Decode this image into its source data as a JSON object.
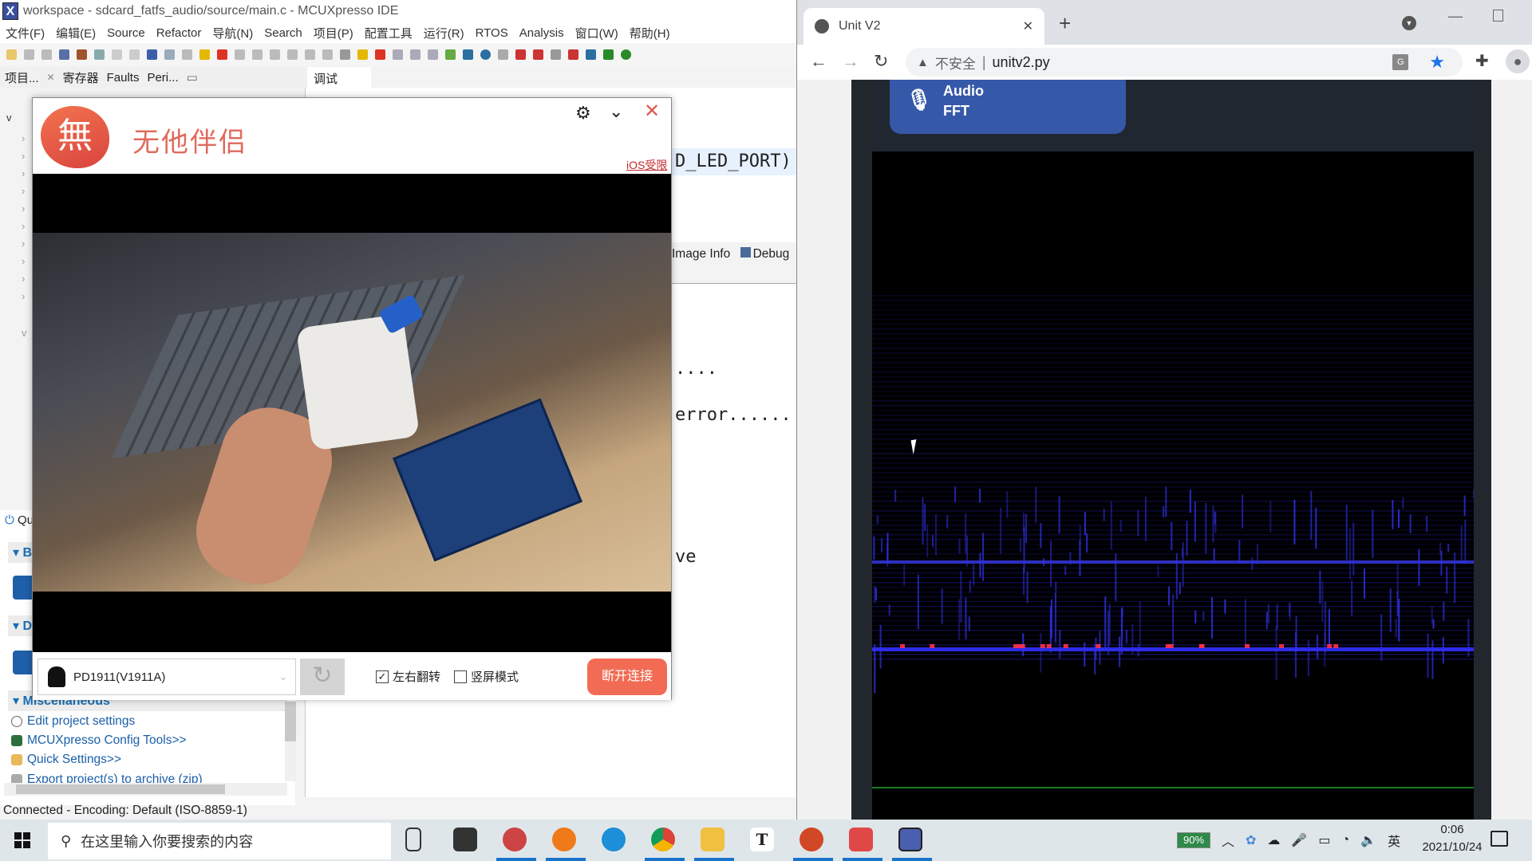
{
  "ide": {
    "title": "workspace - sdcard_fatfs_audio/source/main.c - MCUXpresso IDE",
    "logo": "X",
    "menu": [
      "文件(F)",
      "编辑(E)",
      "Source",
      "Refactor",
      "导航(N)",
      "Search",
      "项目(P)",
      "配置工具",
      "运行(R)",
      "RTOS",
      "Analysis",
      "窗口(W)",
      "帮助(H)"
    ],
    "view_tabs": [
      "项目...",
      "寄存器",
      "Faults",
      "Peri..."
    ],
    "debug_tab": "调试",
    "quickstart": {
      "header": "Qu",
      "sections": [
        "Bu",
        "D",
        "Miscellaneous"
      ],
      "links": [
        "Edit project settings",
        "MCUXpresso Config Tools>>",
        "Quick Settings>>",
        "Export project(s) to archive (zip)"
      ]
    },
    "editor": {
      "highlighted_line": "D_LED_PORT)",
      "tabs": [
        "Image Info",
        "Debug"
      ],
      "console_lines": [
        "....",
        "error......",
        "ve"
      ]
    },
    "status": "Connected - Encoding: Default (ISO-8859-1)"
  },
  "app": {
    "logo": "無",
    "name": "无他伴侣",
    "ios_link": "iOS受限",
    "device": "PD1911(V1911A)",
    "mirror_label": "左右翻转",
    "mirror_checked": true,
    "portrait_label": "竖屏模式",
    "portrait_checked": false,
    "disconnect": "断开连接"
  },
  "browser": {
    "tab_title": "Unit V2",
    "url_warning": "不安全",
    "url": "unitv2.py",
    "page": {
      "button_line1": "Audio",
      "button_line2": "FFT"
    },
    "accent": "#3658a8"
  },
  "taskbar": {
    "search_placeholder": "在这里输入你要搜索的内容",
    "battery": "90%",
    "ime": "英",
    "time": "0:06",
    "date": "2021/10/24"
  }
}
